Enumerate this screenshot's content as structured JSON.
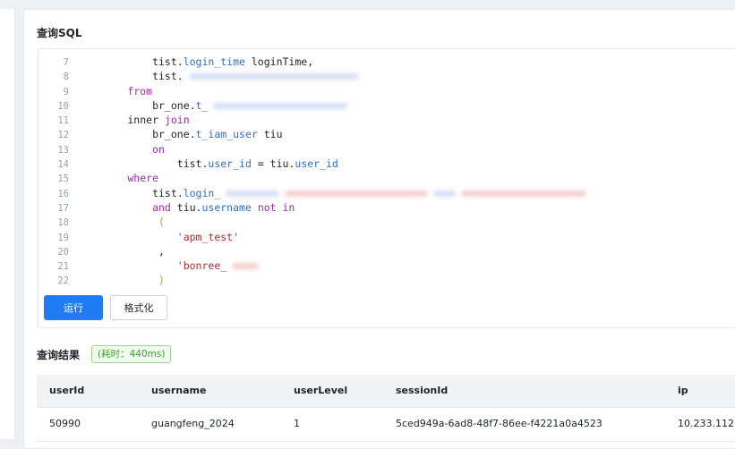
{
  "sql_section": {
    "title": "查询SQL"
  },
  "code": {
    "lines": [
      {
        "num": "7",
        "parts": [
          [
            "plain",
            "            tist."
          ],
          [
            "fld",
            "login_time"
          ],
          [
            "plain",
            " loginTime,"
          ]
        ]
      },
      {
        "num": "8",
        "parts": [
          [
            "plain",
            "            tist."
          ]
        ],
        "blur": [
          [
            "blue",
            190
          ]
        ]
      },
      {
        "num": "9",
        "parts": [
          [
            "kw",
            "        from"
          ]
        ]
      },
      {
        "num": "10",
        "parts": [
          [
            "plain",
            "            br_one."
          ],
          [
            "fld",
            "t_"
          ]
        ],
        "blur": [
          [
            "blue",
            150
          ]
        ]
      },
      {
        "num": "11",
        "parts": [
          [
            "plain",
            "        inner "
          ],
          [
            "kw",
            "join"
          ]
        ]
      },
      {
        "num": "12",
        "parts": [
          [
            "plain",
            "            br_one."
          ],
          [
            "fld",
            "t_iam_user"
          ],
          [
            "plain",
            " tiu"
          ]
        ]
      },
      {
        "num": "13",
        "parts": [
          [
            "kw",
            "            on"
          ]
        ]
      },
      {
        "num": "14",
        "parts": [
          [
            "plain",
            "                tist."
          ],
          [
            "fld",
            "user_id"
          ],
          [
            "plain",
            " = tiu."
          ],
          [
            "fld",
            "user_id"
          ]
        ]
      },
      {
        "num": "15",
        "parts": [
          [
            "kw",
            "        where"
          ]
        ]
      },
      {
        "num": "16",
        "parts": [
          [
            "plain",
            "            tist."
          ],
          [
            "fld",
            "login_"
          ]
        ],
        "blur": [
          [
            "blue",
            60
          ],
          [
            "red",
            160
          ],
          [
            "blue",
            25
          ],
          [
            "red",
            140
          ]
        ]
      },
      {
        "num": "17",
        "parts": [
          [
            "kw",
            "            and"
          ],
          [
            "plain",
            " tiu."
          ],
          [
            "fld",
            "username"
          ],
          [
            "plain",
            " "
          ],
          [
            "kw",
            "not in"
          ]
        ]
      },
      {
        "num": "18",
        "parts": [
          [
            "paren",
            "             ("
          ]
        ]
      },
      {
        "num": "19",
        "parts": [
          [
            "str",
            "                'apm_test'"
          ]
        ]
      },
      {
        "num": "20",
        "parts": [
          [
            "plain",
            "             ,"
          ]
        ]
      },
      {
        "num": "21",
        "parts": [
          [
            "str",
            "                'bonree_"
          ]
        ],
        "blur": [
          [
            "red",
            30
          ]
        ]
      },
      {
        "num": "22",
        "parts": [
          [
            "paren",
            "             )"
          ]
        ]
      }
    ]
  },
  "buttons": {
    "run_label": "运行",
    "format_label": "格式化"
  },
  "results": {
    "title": "查询结果",
    "time_badge": "(耗时：440ms)",
    "columns": [
      "userId",
      "username",
      "userLevel",
      "sessionId",
      "ip"
    ],
    "rows": [
      [
        "50990",
        "guangfeng_2024",
        "1",
        "5ced949a-6ad8-48f7-86ee-f4221a0a4523",
        "10.233.112."
      ]
    ]
  }
}
